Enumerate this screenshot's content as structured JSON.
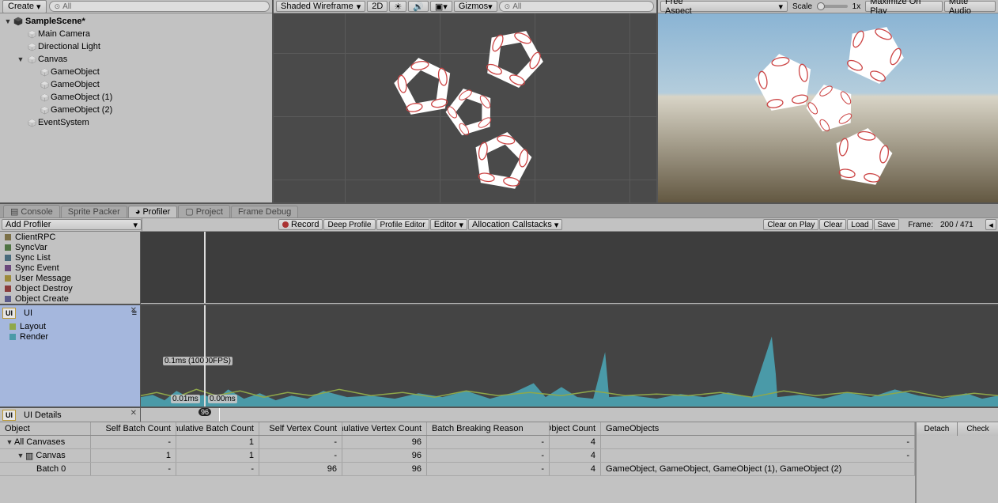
{
  "hierarchy": {
    "create_label": "Create",
    "search_placeholder": "All",
    "scene_name": "SampleScene*",
    "items": [
      {
        "label": "Main Camera",
        "indent": 1,
        "arrow": ""
      },
      {
        "label": "Directional Light",
        "indent": 1,
        "arrow": ""
      },
      {
        "label": "Canvas",
        "indent": 1,
        "arrow": "▼"
      },
      {
        "label": "GameObject",
        "indent": 2,
        "arrow": ""
      },
      {
        "label": "GameObject",
        "indent": 2,
        "arrow": ""
      },
      {
        "label": "GameObject (1)",
        "indent": 2,
        "arrow": ""
      },
      {
        "label": "GameObject (2)",
        "indent": 2,
        "arrow": ""
      },
      {
        "label": "EventSystem",
        "indent": 1,
        "arrow": ""
      }
    ]
  },
  "scene_toolbar": {
    "shade_mode": "Shaded Wireframe",
    "btn_2d": "2D",
    "gizmos": "Gizmos",
    "search_placeholder": "All"
  },
  "game_toolbar": {
    "aspect": "Free Aspect",
    "scale_label": "Scale",
    "scale_value": "1x",
    "maximize": "Maximize On Play",
    "mute": "Mute Audio"
  },
  "tabs": {
    "console": "Console",
    "sprite_packer": "Sprite Packer",
    "profiler": "Profiler",
    "project": "Project",
    "frame_debug": "Frame Debug"
  },
  "profiler_toolbar": {
    "add_profiler": "Add Profiler",
    "record": "Record",
    "deep_profile": "Deep Profile",
    "profile_editor": "Profile Editor",
    "editor": "Editor",
    "alloc": "Allocation Callstacks",
    "clear_on_play": "Clear on Play",
    "clear": "Clear",
    "load": "Load",
    "save": "Save",
    "frame_label": "Frame:",
    "frame_value": "200 / 471"
  },
  "profiler_categories": [
    {
      "label": "ClientRPC",
      "color": "#7b7048"
    },
    {
      "label": "SyncVar",
      "color": "#4f7343"
    },
    {
      "label": "Sync List",
      "color": "#486a7b"
    },
    {
      "label": "Sync Event",
      "color": "#6a487b"
    },
    {
      "label": "User Message",
      "color": "#9c8a3b"
    },
    {
      "label": "Object Destroy",
      "color": "#8a3b3b"
    },
    {
      "label": "Object Create",
      "color": "#5a5a8a"
    }
  ],
  "ui_track": {
    "badge": "UI",
    "title": "UI",
    "legend": [
      {
        "label": "Layout",
        "color": "#8fa84a"
      },
      {
        "label": "Render",
        "color": "#4a9aa8"
      }
    ],
    "label_top": "0.1ms (10000FPS)",
    "label_left": "0.01ms",
    "label_cursor": "0.00ms",
    "frame_marker": "96"
  },
  "ui_details": {
    "badge": "UI",
    "title": "UI Details"
  },
  "table": {
    "headers": {
      "object": "Object",
      "self_batch": "Self Batch Count",
      "cum_batch": "Cumulative Batch Count",
      "self_vert": "Self Vertex Count",
      "cum_vert": "Cumulative Vertex Count",
      "reason": "Batch Breaking Reason",
      "go_count": "GameObject Count",
      "gos": "GameObjects"
    },
    "rows": [
      {
        "object": "All Canvases",
        "indent": 0,
        "arrow": "▼",
        "self_batch": "-",
        "cum_batch": "1",
        "self_vert": "-",
        "cum_vert": "96",
        "reason": "-",
        "go": "4",
        "gos": "-"
      },
      {
        "object": "Canvas",
        "indent": 1,
        "arrow": "▼",
        "self_batch": "1",
        "cum_batch": "1",
        "self_vert": "-",
        "cum_vert": "96",
        "reason": "-",
        "go": "4",
        "gos": "-"
      },
      {
        "object": "Batch 0",
        "indent": 2,
        "arrow": "",
        "self_batch": "-",
        "cum_batch": "-",
        "self_vert": "96",
        "cum_vert": "96",
        "reason": "-",
        "go": "4",
        "gos": "GameObject, GameObject, GameObject (1), GameObject (2)"
      }
    ],
    "detach": "Detach",
    "check": "Check"
  }
}
